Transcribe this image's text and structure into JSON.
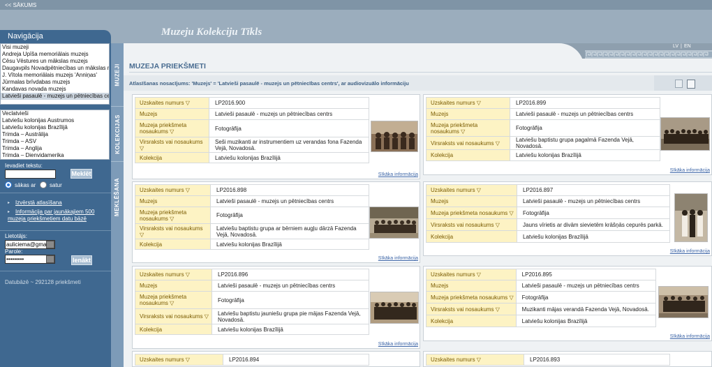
{
  "top": {
    "back_link": "<< SĀKUMS"
  },
  "site_title": "Muzeju Kolekciju Tīkls",
  "lang": {
    "lv": "LV",
    "sep": "|",
    "en": "EN"
  },
  "nav": {
    "title": "Navigācija",
    "museums": [
      "Visi muzeji",
      "Andreja Upīša memoriālais muzejs",
      "Cēsu Vēstures un mākslas muzejs",
      "Daugavpils Novadpētniecības un mākslas muzejs",
      "J. Vītola memoriālais muzejs 'Anniņas'",
      "Jūrmalas brīvdabas muzejs",
      "Kandavas novada muzejs",
      "Latvieši pasaulē - muzejs un pētniecības centrs"
    ],
    "collections": [
      "Veclatvieši",
      "Latviešu kolonijas Austrumos",
      "Latviešu kolonijas Brazīlijā",
      "Trimda – Austrālija",
      "Trimda – ASV",
      "Trimda – Anglija",
      "Trimda – Dienvidamerika"
    ]
  },
  "search": {
    "label": "Ievadiet tekstu:",
    "value": "",
    "button": "Meklēt",
    "option_starts": "sākas ar",
    "option_contains": "satur"
  },
  "links": {
    "advanced": "Izvērstā atlasīšana",
    "info_line1": "Informācija par jaunākajiem 500",
    "info_line2": "muzeja priekšmetiem datu bāzē"
  },
  "login": {
    "user_label": "Lietotājs:",
    "user_value": "auliciema@gmail.com",
    "pass_label": "Parole:",
    "pass_value": "•••••••••",
    "button": "Ienākt"
  },
  "db_count": "Datubāzē ~ 292128 priekšmeti",
  "vtabs": {
    "museums": "MUZEJI",
    "collections": "KOLEKCIJAS",
    "search": "MEKLĒŠANA"
  },
  "page_title": "MUZEJA PRIEKŠMETI",
  "criteria": "Atlasīšanas nosacījums: 'Muzejs' = 'Latvieši pasaulē - muzejs un pētniecības centrs', ar audiovizuālo informāciju",
  "labels": {
    "number": "Uzskaites numurs ▽",
    "museum": "Muzejs",
    "name_line1": "Muzeja priekšmeta",
    "name_line2": "nosaukums ▽",
    "name_inline": "Muzeja priekšmeta nosaukums ▽",
    "title": "Virsraksts vai nosaukums ▽",
    "collection": "Kolekcija",
    "more": "Sīkāka informācija"
  },
  "items": [
    {
      "number": "LP2016.900",
      "museum": "Latvieši pasaulē - muzejs un pētniecības centrs",
      "name": "Fotogrāfija",
      "title": "Seši muzikanti ar instrumentiem uz verandas fona Fazenda Vejā, Novadosā.",
      "collection": "Latviešu kolonijas Brazīlijā"
    },
    {
      "number": "LP2016.899",
      "museum": "Latvieši pasaulē - muzejs un pētniecības centrs",
      "name": "Fotogrāfija",
      "title": "Latviešu baptistu grupa pagalmā Fazenda Vejā, Novadosā.",
      "collection": "Latviešu kolonijas Brazīlijā"
    },
    {
      "number": "LP2016.898",
      "museum": "Latvieši pasaulē - muzejs un pētniecības centrs",
      "name": "Fotogrāfija",
      "title": "Latviešu baptistu grupa ar bērniem augļu dārzā Fazenda Vejā, Novadosā.",
      "collection": "Latviešu kolonijas Brazīlijā"
    },
    {
      "number": "LP2016.897",
      "museum": "Latvieši pasaulē - muzejs un pētniecības centrs",
      "name": "Fotogrāfija",
      "title": "Jauns vīrietis ar divām sievietēm krāšņās cepurēs parkā.",
      "collection": "Latviešu kolonijas Brazīlijā"
    },
    {
      "number": "LP2016.896",
      "museum": "Latvieši pasaulē - muzejs un pētniecības centrs",
      "name": "Fotogrāfija",
      "title": "Latviešu baptistu jauniešu grupa pie mājas Fazenda Vejā, Novadosā.",
      "collection": "Latviešu kolonijas Brazīlijā"
    },
    {
      "number": "LP2016.895",
      "museum": "Latvieši pasaulē - muzejs un pētniecības centrs",
      "name": "Fotogrāfija",
      "title": "Muzikanti mājas verandā Fazenda Vejā, Novadosā.",
      "collection": "Latviešu kolonijas Brazīlijā"
    },
    {
      "number": "LP2016.894"
    },
    {
      "number": "LP2016.893"
    }
  ]
}
